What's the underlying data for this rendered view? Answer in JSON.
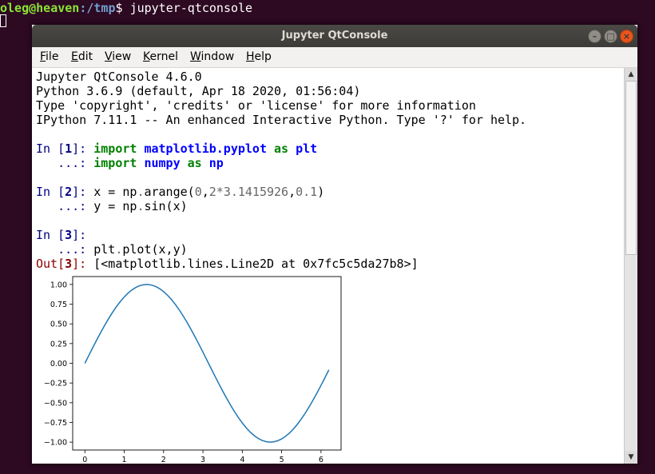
{
  "terminal": {
    "user_host": "oleg@heaven",
    "path": ":/tmp",
    "prompt_end": "$ ",
    "command": "jupyter-qtconsole"
  },
  "window": {
    "title": "Jupyter QtConsole",
    "buttons": {
      "minimize": "–",
      "maximize": "□",
      "close": "×"
    }
  },
  "menu": [
    {
      "ul": "F",
      "rest": "ile"
    },
    {
      "ul": "E",
      "rest": "dit"
    },
    {
      "ul": "V",
      "rest": "iew"
    },
    {
      "ul": "K",
      "rest": "ernel"
    },
    {
      "ul": "W",
      "rest": "indow"
    },
    {
      "ul": "H",
      "rest": "elp"
    }
  ],
  "banner": [
    "Jupyter QtConsole 4.6.0",
    "Python 3.6.9 (default, Apr 18 2020, 01:56:04)",
    "Type 'copyright', 'credits' or 'license' for more information",
    "IPython 7.11.1 -- An enhanced Interactive Python. Type '?' for help."
  ],
  "cells": {
    "in1": {
      "prompt": "In [",
      "num": "1",
      "close": "]: "
    },
    "in1_l1": {
      "kw1": "import",
      "mod": "matplotlib.pyplot",
      "kw2": "as",
      "alias": "plt"
    },
    "cont": "   ...: ",
    "in1_l2": {
      "kw1": "import",
      "mod": "numpy",
      "kw2": "as",
      "alias": "np"
    },
    "in2": {
      "prompt": "In [",
      "num": "2",
      "close": "]: "
    },
    "in2_l1": {
      "a": "x = np",
      "dot": ".",
      "b": "arange(",
      "n1": "0",
      "c": ",",
      "n2": "2",
      "star": "*",
      "n3": "3.1415926",
      "d": ",",
      "n4": "0.1",
      "e": ")"
    },
    "in2_l2": {
      "a": "y = np",
      "dot": ".",
      "b": "sin(x)"
    },
    "in3": {
      "prompt": "In [",
      "num": "3",
      "close": "]: "
    },
    "in3_l2": {
      "a": "plt",
      "dot": ".",
      "b": "plot(x,y)"
    },
    "out3": {
      "prompt": "Out[",
      "num": "3",
      "close": "]: ",
      "text": "[<matplotlib.lines.Line2D at 0x7fc5c5da27b8>]"
    }
  },
  "scrollbar": {
    "up": "▲",
    "down": "▼"
  },
  "chart_data": {
    "type": "line",
    "title": "",
    "xlabel": "",
    "ylabel": "",
    "xlim": [
      -0.31,
      6.51
    ],
    "ylim": [
      -1.1,
      1.1
    ],
    "xticks": [
      "0",
      "1",
      "2",
      "3",
      "4",
      "5",
      "6"
    ],
    "xtick_values": [
      0,
      1,
      2,
      3,
      4,
      5,
      6
    ],
    "yticks": [
      "1.00",
      "0.75",
      "0.50",
      "0.25",
      "0.00",
      "−0.25",
      "−0.50",
      "−0.75",
      "−1.00"
    ],
    "ytick_values": [
      1,
      0.75,
      0.5,
      0.25,
      0,
      -0.25,
      -0.5,
      -0.75,
      -1
    ],
    "grid": false,
    "series": [
      {
        "color": "#1f77b4",
        "x": [
          0.0,
          0.1,
          0.2,
          0.3,
          0.4,
          0.5,
          0.6,
          0.7,
          0.8,
          0.9,
          1.0,
          1.1,
          1.2,
          1.3,
          1.4,
          1.5,
          1.6,
          1.7,
          1.8,
          1.9,
          2.0,
          2.1,
          2.2,
          2.3,
          2.4,
          2.5,
          2.6,
          2.7,
          2.8,
          2.9,
          3.0,
          3.1,
          3.2,
          3.3,
          3.4,
          3.5,
          3.6,
          3.7,
          3.8,
          3.9,
          4.0,
          4.1,
          4.2,
          4.3,
          4.4,
          4.5,
          4.6,
          4.7,
          4.8,
          4.9,
          5.0,
          5.1,
          5.2,
          5.3,
          5.4,
          5.5,
          5.6,
          5.7,
          5.8,
          5.9,
          6.0,
          6.1,
          6.2
        ],
        "y": [
          0.0,
          0.0998,
          0.1987,
          0.2955,
          0.3894,
          0.4794,
          0.5646,
          0.6442,
          0.7174,
          0.7833,
          0.8415,
          0.8912,
          0.932,
          0.9636,
          0.9854,
          0.9975,
          0.9996,
          0.9917,
          0.9738,
          0.9463,
          0.9093,
          0.8632,
          0.8085,
          0.7457,
          0.6755,
          0.5985,
          0.5155,
          0.4274,
          0.335,
          0.2392,
          0.1411,
          0.0416,
          -0.0584,
          -0.1577,
          -0.2555,
          -0.3508,
          -0.4425,
          -0.5298,
          -0.6119,
          -0.6878,
          -0.7568,
          -0.8183,
          -0.8716,
          -0.9162,
          -0.9516,
          -0.9775,
          -0.9937,
          -0.9999,
          -0.9962,
          -0.9825,
          -0.9589,
          -0.9258,
          -0.8835,
          -0.8323,
          -0.7728,
          -0.7055,
          -0.6313,
          -0.5507,
          -0.4646,
          -0.3739,
          -0.2794,
          -0.1822,
          -0.0831
        ]
      }
    ]
  }
}
